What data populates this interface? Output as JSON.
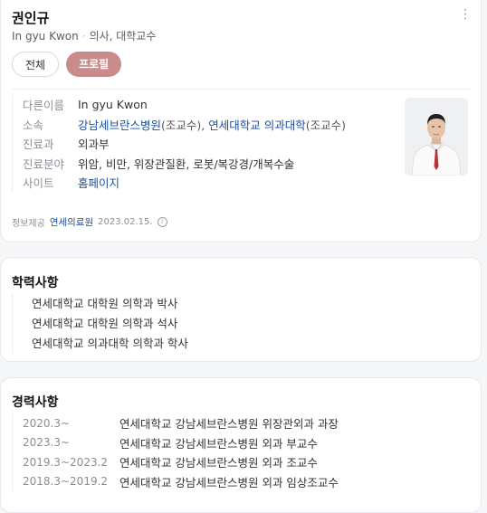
{
  "profile": {
    "name": "권인규",
    "english_name": "In gyu Kwon",
    "position": "의사, 대학교수",
    "more_icon": "⋮",
    "tabs": [
      {
        "label": "전체",
        "active": false
      },
      {
        "label": "프로필",
        "active": true
      }
    ],
    "info": {
      "other_name_label": "다른이름",
      "other_name_value": "In gyu Kwon",
      "affiliation_label": "소속",
      "affiliation_1": "강남세브란스병원",
      "affiliation_1_role": "(조교수), ",
      "affiliation_2": "연세대학교 의과대학",
      "affiliation_2_role": "(조교수)",
      "department_label": "진료과",
      "department_value": "외과부",
      "specialty_label": "진료분야",
      "specialty_value": "위암, 비만, 위장관질환, 로봇/복강경/개복수술",
      "site_label": "사이트",
      "site_value": "홈페이지"
    },
    "footer": {
      "label": "정보제공",
      "source": "연세의료원",
      "date": "2023.02.15.",
      "info_icon": "i"
    }
  },
  "education": {
    "title": "학력사항",
    "items": [
      "연세대학교 대학원 의학과 박사",
      "연세대학교 대학원 의학과 석사",
      "연세대학교 의과대학 의학과 학사"
    ]
  },
  "career": {
    "title": "경력사항",
    "items": [
      {
        "date": "2020.3~",
        "desc": "연세대학교 강남세브란스병원 위장관외과 과장"
      },
      {
        "date": "2023.3~",
        "desc": "연세대학교 강남세브란스병원 외과 부교수"
      },
      {
        "date": "2019.3~2023.2",
        "desc": "연세대학교 강남세브란스병원 외과 조교수"
      },
      {
        "date": "2018.3~2019.2",
        "desc": "연세대학교 강남세브란스병원 외과 임상조교수"
      }
    ]
  },
  "colors": {
    "active_tab": "#c98c8b",
    "link": "#1a4fa0"
  }
}
